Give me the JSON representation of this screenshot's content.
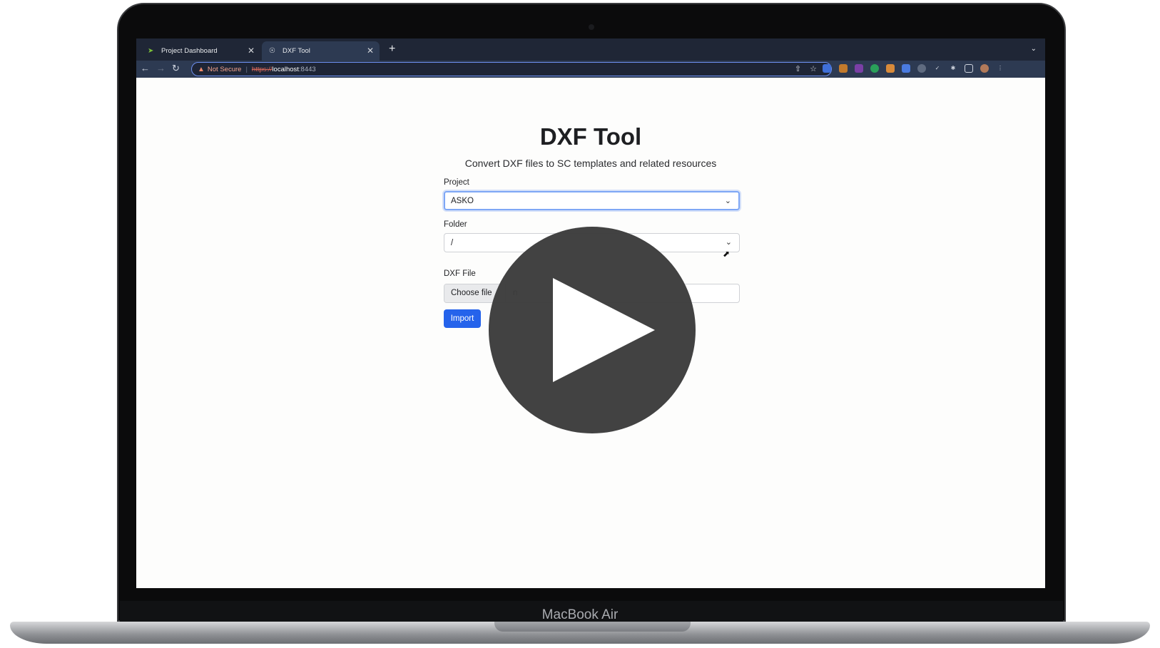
{
  "device": {
    "brand_label": "MacBook Air"
  },
  "browser": {
    "tabs": [
      {
        "title": "Project Dashboard",
        "icon": "chevron-logo-icon",
        "active": false
      },
      {
        "title": "DXF Tool",
        "icon": "globe-icon",
        "active": true
      }
    ],
    "address": {
      "security_label": "Not Secure",
      "scheme": "https://",
      "host": "localhost",
      "port": ":8443"
    }
  },
  "page": {
    "title": "DXF Tool",
    "subtitle": "Convert DXF files to SC templates and related resources",
    "project": {
      "label": "Project",
      "value": "ASKO"
    },
    "folder": {
      "label": "Folder",
      "value": "/"
    },
    "dxf_file": {
      "label": "DXF File",
      "button_label": "Choose file",
      "status_fragment": "n"
    },
    "import_label": "Import"
  },
  "colors": {
    "accent": "#2563eb",
    "tabstrip": "#1f2636",
    "toolbar": "#2d3a52",
    "play_overlay": "#3c3c3c"
  },
  "overlay": {
    "icon": "play-icon"
  }
}
